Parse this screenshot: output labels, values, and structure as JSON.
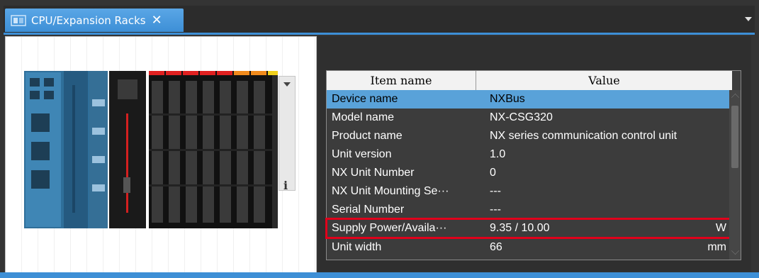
{
  "tab": {
    "label": "CPU/Expansion Racks",
    "close_label": "✕"
  },
  "colors": {
    "accent": "#3d8fd6",
    "selected_row": "#59a2d9",
    "highlight_box": "#e0001b"
  },
  "rack": {
    "info_label": "i"
  },
  "properties": {
    "headers": {
      "name": "Item name",
      "value": "Value"
    },
    "rows": [
      {
        "name": "Device name",
        "value": "NXBus",
        "unit": ""
      },
      {
        "name": "Model name",
        "value": "NX-CSG320",
        "unit": ""
      },
      {
        "name": "Product name",
        "value": "NX series communication control unit",
        "unit": ""
      },
      {
        "name": "Unit version",
        "value": "1.0",
        "unit": ""
      },
      {
        "name": "NX Unit Number",
        "value": "0",
        "unit": ""
      },
      {
        "name": "NX Unit Mounting Se···",
        "value": "---",
        "unit": ""
      },
      {
        "name": "Serial Number",
        "value": "---",
        "unit": ""
      },
      {
        "name": "Supply Power/Availa···",
        "value": "9.35 / 10.00",
        "unit": "W"
      },
      {
        "name": "Unit width",
        "value": "66",
        "unit": "mm"
      }
    ]
  }
}
